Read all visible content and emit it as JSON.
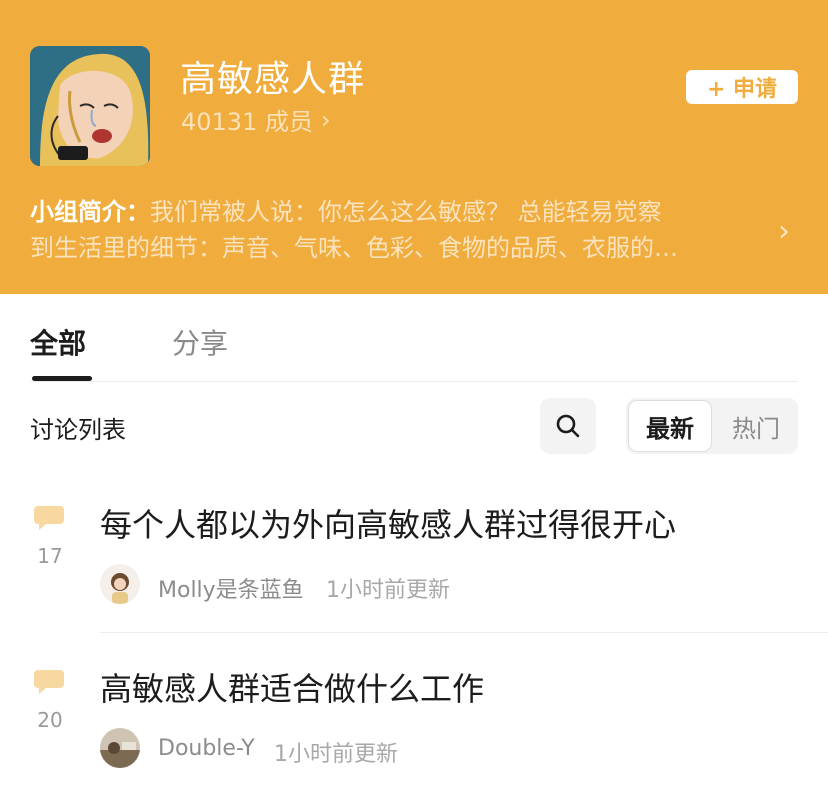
{
  "group": {
    "name": "高敏感人群",
    "members": "40131 成员",
    "join_label": "+ 申请",
    "intro_label": "小组简介：",
    "intro_line1": "我们常被人说：你怎么这么敏感？ 总能轻易觉察",
    "intro_line2": "到生活里的细节：声音、气味、色彩、食物的品质、衣服的…"
  },
  "tabs": [
    {
      "label": "全部",
      "active": true
    },
    {
      "label": "分享",
      "active": false
    }
  ],
  "list": {
    "title": "讨论列表",
    "sort_latest": "最新",
    "sort_hot": "热门"
  },
  "posts": [
    {
      "title": "每个人都以为外向高敏感人群过得很开心",
      "comments": "17",
      "author": "Molly是条蓝鱼",
      "time": "1小时前更新"
    },
    {
      "title": "高敏感人群适合做什么工作",
      "comments": "20",
      "author": "Double-Y",
      "time": "1小时前更新"
    }
  ],
  "colors": {
    "header_bg": "#f0ac3c",
    "comment_icon": "#f6d8a0"
  },
  "icons": [
    "search-icon",
    "chevron-right-icon",
    "comment-bubble-icon"
  ]
}
